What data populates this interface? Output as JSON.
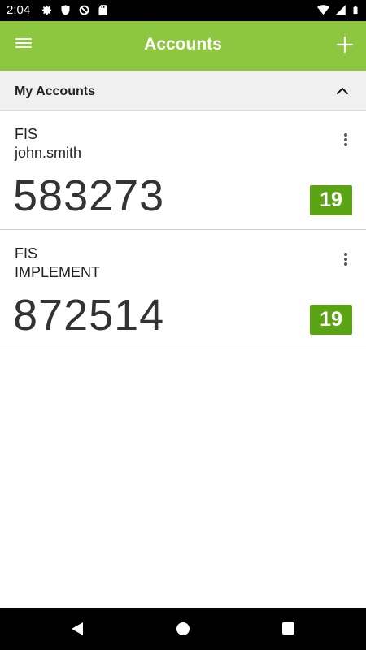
{
  "status_bar": {
    "time": "2:04",
    "left_icons": [
      "settings-icon",
      "shield-icon",
      "data-saver-icon",
      "sd-card-icon"
    ],
    "right_icons": [
      "wifi-icon",
      "signal-icon",
      "battery-icon"
    ]
  },
  "app_bar": {
    "title": "Accounts",
    "menu_icon": "menu-icon",
    "add_icon": "plus-icon",
    "color": "#8dc63f"
  },
  "section": {
    "title": "My Accounts",
    "collapse_icon": "chevron-up-icon"
  },
  "accounts": [
    {
      "issuer": "FIS",
      "name": "john.smith",
      "code": "583273",
      "seconds_left": "19"
    },
    {
      "issuer": "FIS",
      "name": "IMPLEMENT",
      "code": "872514",
      "seconds_left": "19"
    }
  ],
  "colors": {
    "timer_badge": "#5aa313"
  },
  "nav_bar": {
    "icons": [
      "back-icon",
      "home-icon",
      "recents-icon"
    ]
  }
}
